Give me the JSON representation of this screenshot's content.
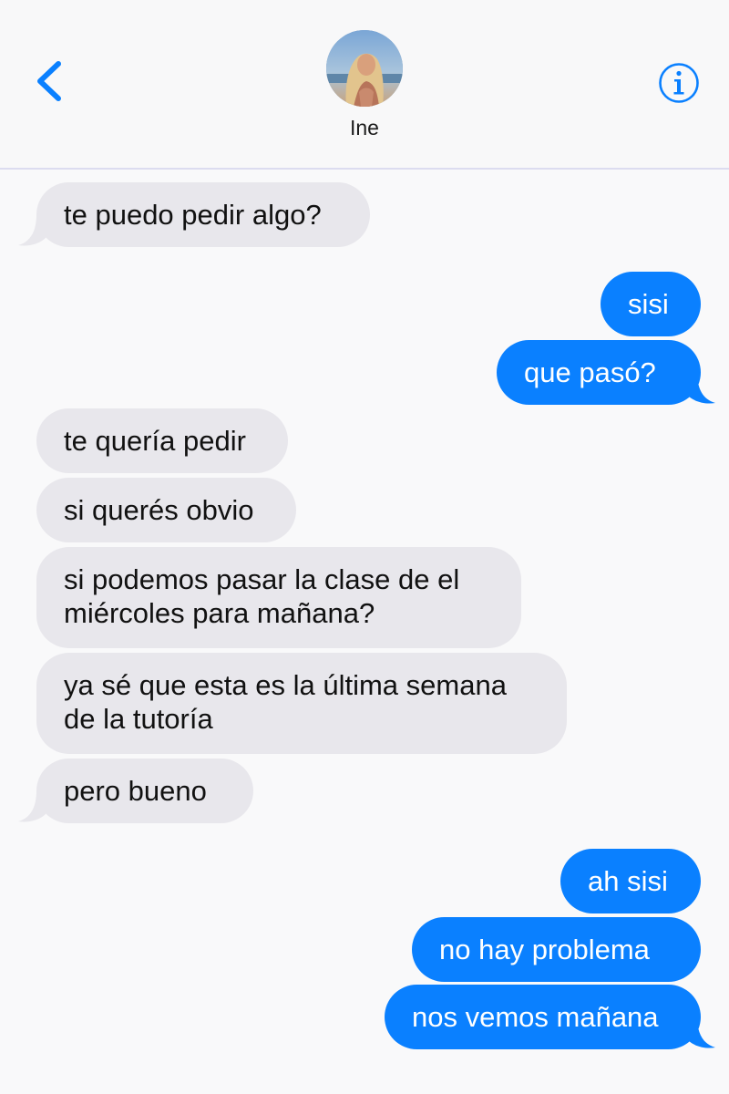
{
  "header": {
    "contact_name": "Ine",
    "accent_color": "#0a80ff",
    "back_icon": "chevron-left-icon",
    "info_icon": "info-circle-icon"
  },
  "colors": {
    "sent_bubble": "#0a80ff",
    "received_bubble": "#e8e7ec",
    "background": "#f9f9fa"
  },
  "messages": [
    {
      "from": "contact",
      "text": "te puedo pedir algo?"
    },
    {
      "from": "me",
      "text": "sisi"
    },
    {
      "from": "me",
      "text": "que pasó?"
    },
    {
      "from": "contact",
      "text": "te quería pedir"
    },
    {
      "from": "contact",
      "text": "si querés obvio"
    },
    {
      "from": "contact",
      "line1": "si podemos pasar la clase de el",
      "line2": "miércoles para mañana?"
    },
    {
      "from": "contact",
      "line1": "ya sé que esta es la última semana",
      "line2": "de la tutoría"
    },
    {
      "from": "contact",
      "text": "pero bueno"
    },
    {
      "from": "me",
      "text": "ah sisi"
    },
    {
      "from": "me",
      "text": "no hay problema"
    },
    {
      "from": "me",
      "text": "nos vemos mañana"
    }
  ]
}
